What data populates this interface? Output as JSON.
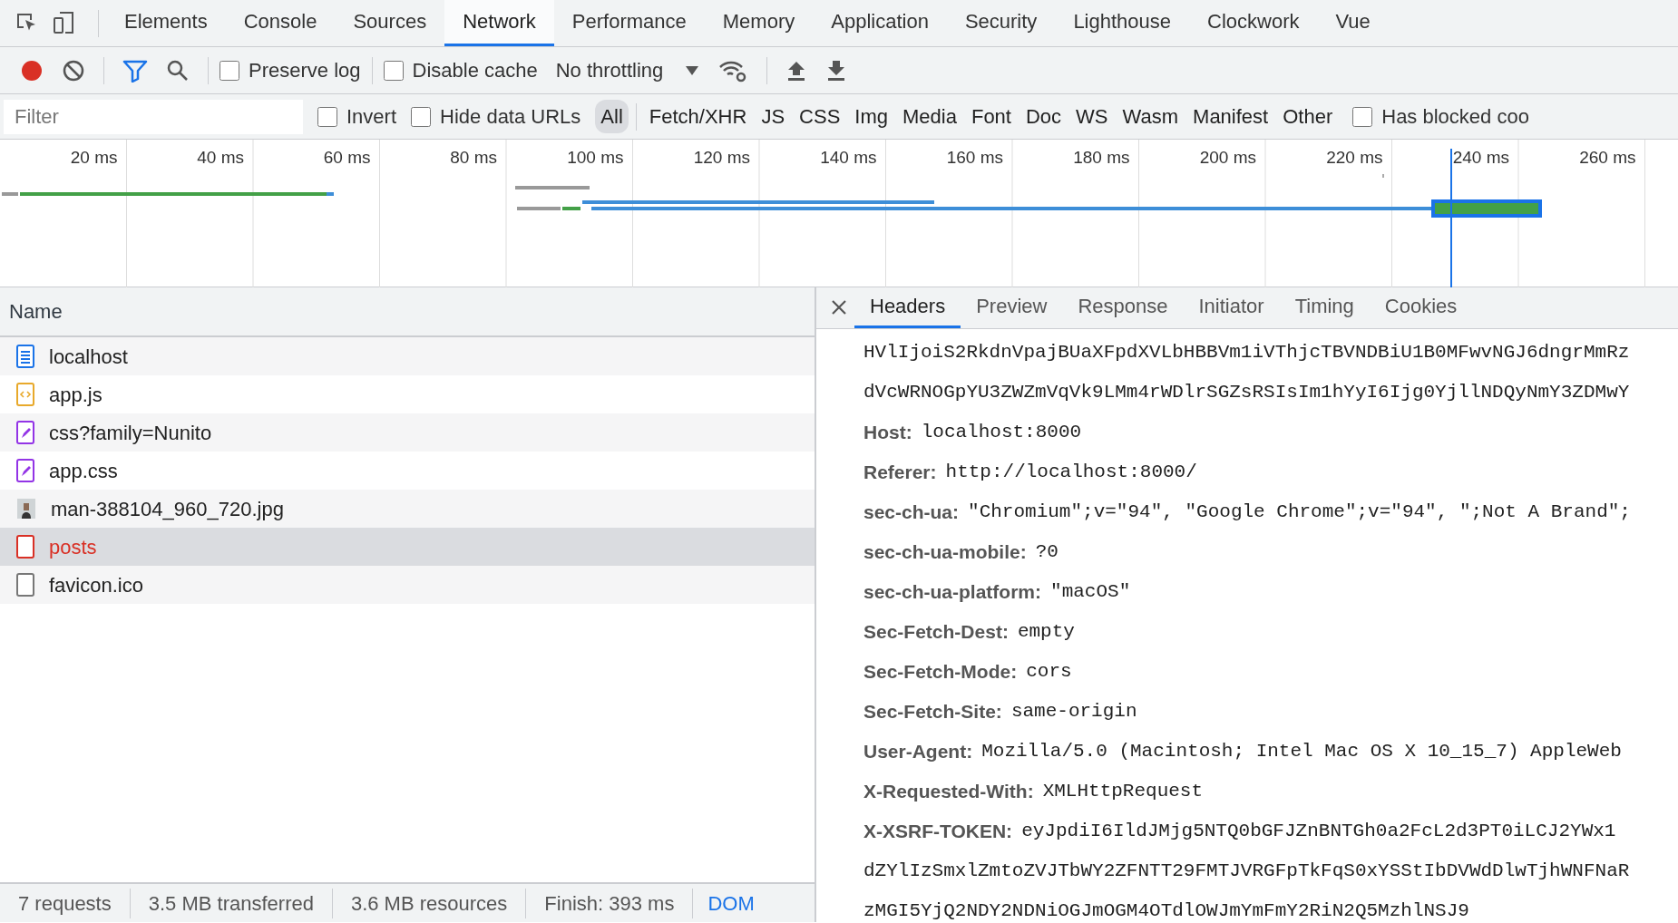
{
  "devtools_tabs": [
    {
      "label": "Elements",
      "selected": false
    },
    {
      "label": "Console",
      "selected": false
    },
    {
      "label": "Sources",
      "selected": false
    },
    {
      "label": "Network",
      "selected": true
    },
    {
      "label": "Performance",
      "selected": false
    },
    {
      "label": "Memory",
      "selected": false
    },
    {
      "label": "Application",
      "selected": false
    },
    {
      "label": "Security",
      "selected": false
    },
    {
      "label": "Lighthouse",
      "selected": false
    },
    {
      "label": "Clockwork",
      "selected": false
    },
    {
      "label": "Vue",
      "selected": false
    }
  ],
  "toolbar": {
    "recording": true,
    "filter_active": true,
    "preserve_log": {
      "label": "Preserve log",
      "checked": false
    },
    "disable_cache": {
      "label": "Disable cache",
      "checked": false
    },
    "throttling": "No throttling"
  },
  "filter_bar": {
    "placeholder": "Filter",
    "invert": {
      "label": "Invert",
      "checked": false
    },
    "hide_data_urls": {
      "label": "Hide data URLs",
      "checked": false
    },
    "types": [
      {
        "label": "All",
        "selected": true
      },
      {
        "label": "Fetch/XHR",
        "selected": false
      },
      {
        "label": "JS",
        "selected": false
      },
      {
        "label": "CSS",
        "selected": false
      },
      {
        "label": "Img",
        "selected": false
      },
      {
        "label": "Media",
        "selected": false
      },
      {
        "label": "Font",
        "selected": false
      },
      {
        "label": "Doc",
        "selected": false
      },
      {
        "label": "WS",
        "selected": false
      },
      {
        "label": "Wasm",
        "selected": false
      },
      {
        "label": "Manifest",
        "selected": false
      },
      {
        "label": "Other",
        "selected": false
      }
    ],
    "has_blocked": {
      "label": "Has blocked coo",
      "checked": false
    }
  },
  "timeline": {
    "ticks": [
      "20 ms",
      "40 ms",
      "60 ms",
      "80 ms",
      "100 ms",
      "120 ms",
      "140 ms",
      "160 ms",
      "180 ms",
      "200 ms",
      "220 ms",
      "240 ms",
      "260 ms"
    ]
  },
  "requests": {
    "column": "Name",
    "rows": [
      {
        "kind": "document",
        "name": "localhost",
        "selected": false,
        "failed": false
      },
      {
        "kind": "script",
        "name": "app.js",
        "selected": false,
        "failed": false
      },
      {
        "kind": "stylesheet",
        "name": "css?family=Nunito",
        "selected": false,
        "failed": false
      },
      {
        "kind": "stylesheet",
        "name": "app.css",
        "selected": false,
        "failed": false
      },
      {
        "kind": "image",
        "name": "man-388104_960_720.jpg",
        "selected": false,
        "failed": false
      },
      {
        "kind": "other",
        "name": "posts",
        "selected": true,
        "failed": true
      },
      {
        "kind": "other",
        "name": "favicon.ico",
        "selected": false,
        "failed": false
      }
    ]
  },
  "status_bar": [
    {
      "kind": "summary",
      "text": "7 requests"
    },
    {
      "kind": "summary",
      "text": "3.5 MB transferred"
    },
    {
      "kind": "summary",
      "text": "3.6 MB resources"
    },
    {
      "kind": "summary",
      "text": "Finish: 393 ms"
    },
    {
      "kind": "link",
      "text": "DOM"
    }
  ],
  "details": {
    "tabs": [
      {
        "label": "Headers",
        "selected": true
      },
      {
        "label": "Preview",
        "selected": false
      },
      {
        "label": "Response",
        "selected": false
      },
      {
        "label": "Initiator",
        "selected": false
      },
      {
        "label": "Timing",
        "selected": false
      },
      {
        "label": "Cookies",
        "selected": false
      }
    ],
    "headers": [
      {
        "kind": "continuation",
        "value": "HVlIjoiS2RkdnVpajBUaXFpdXVLbHBBVm1iVThjcTBVNDBiU1B0MFwvNGJ6dngrMmRz"
      },
      {
        "kind": "continuation",
        "value": "dVcWRNOGpYU3ZWZmVqVk9LMm4rWDlrSGZsRSIsIm1hYyI6Ijg0YjllNDQyNmY3ZDMwY"
      },
      {
        "kind": "header",
        "name": "Host:",
        "value": "localhost:8000"
      },
      {
        "kind": "header",
        "name": "Referer:",
        "value": "http://localhost:8000/"
      },
      {
        "kind": "header",
        "name": "sec-ch-ua:",
        "value": "\"Chromium\";v=\"94\", \"Google Chrome\";v=\"94\", \";Not A Brand\";"
      },
      {
        "kind": "header",
        "name": "sec-ch-ua-mobile:",
        "value": "?0"
      },
      {
        "kind": "header",
        "name": "sec-ch-ua-platform:",
        "value": "\"macOS\""
      },
      {
        "kind": "header",
        "name": "Sec-Fetch-Dest:",
        "value": "empty"
      },
      {
        "kind": "header",
        "name": "Sec-Fetch-Mode:",
        "value": "cors"
      },
      {
        "kind": "header",
        "name": "Sec-Fetch-Site:",
        "value": "same-origin"
      },
      {
        "kind": "header",
        "name": "User-Agent:",
        "value": "Mozilla/5.0 (Macintosh; Intel Mac OS X 10_15_7) AppleWeb"
      },
      {
        "kind": "header",
        "name": "X-Requested-With:",
        "value": "XMLHttpRequest"
      },
      {
        "kind": "header",
        "name": "X-XSRF-TOKEN:",
        "value": "eyJpdiI6IldJMjg5NTQ0bGFJZnBNTGh0a2FcL2d3PT0iLCJ2YWx1"
      },
      {
        "kind": "continuation",
        "value": "dZYlIzSmxlZmtoZVJTbWY2ZFNTT29FMTJVRGFpTkFqS0xYSStIbDVWdDlwTjhWNFNaR"
      },
      {
        "kind": "continuation",
        "value": "zMGI5YjQ2NDY2NDNiOGJmOGM4OTdlOWJmYmFmY2RiN2Q5MzhlNSJ9"
      }
    ]
  }
}
